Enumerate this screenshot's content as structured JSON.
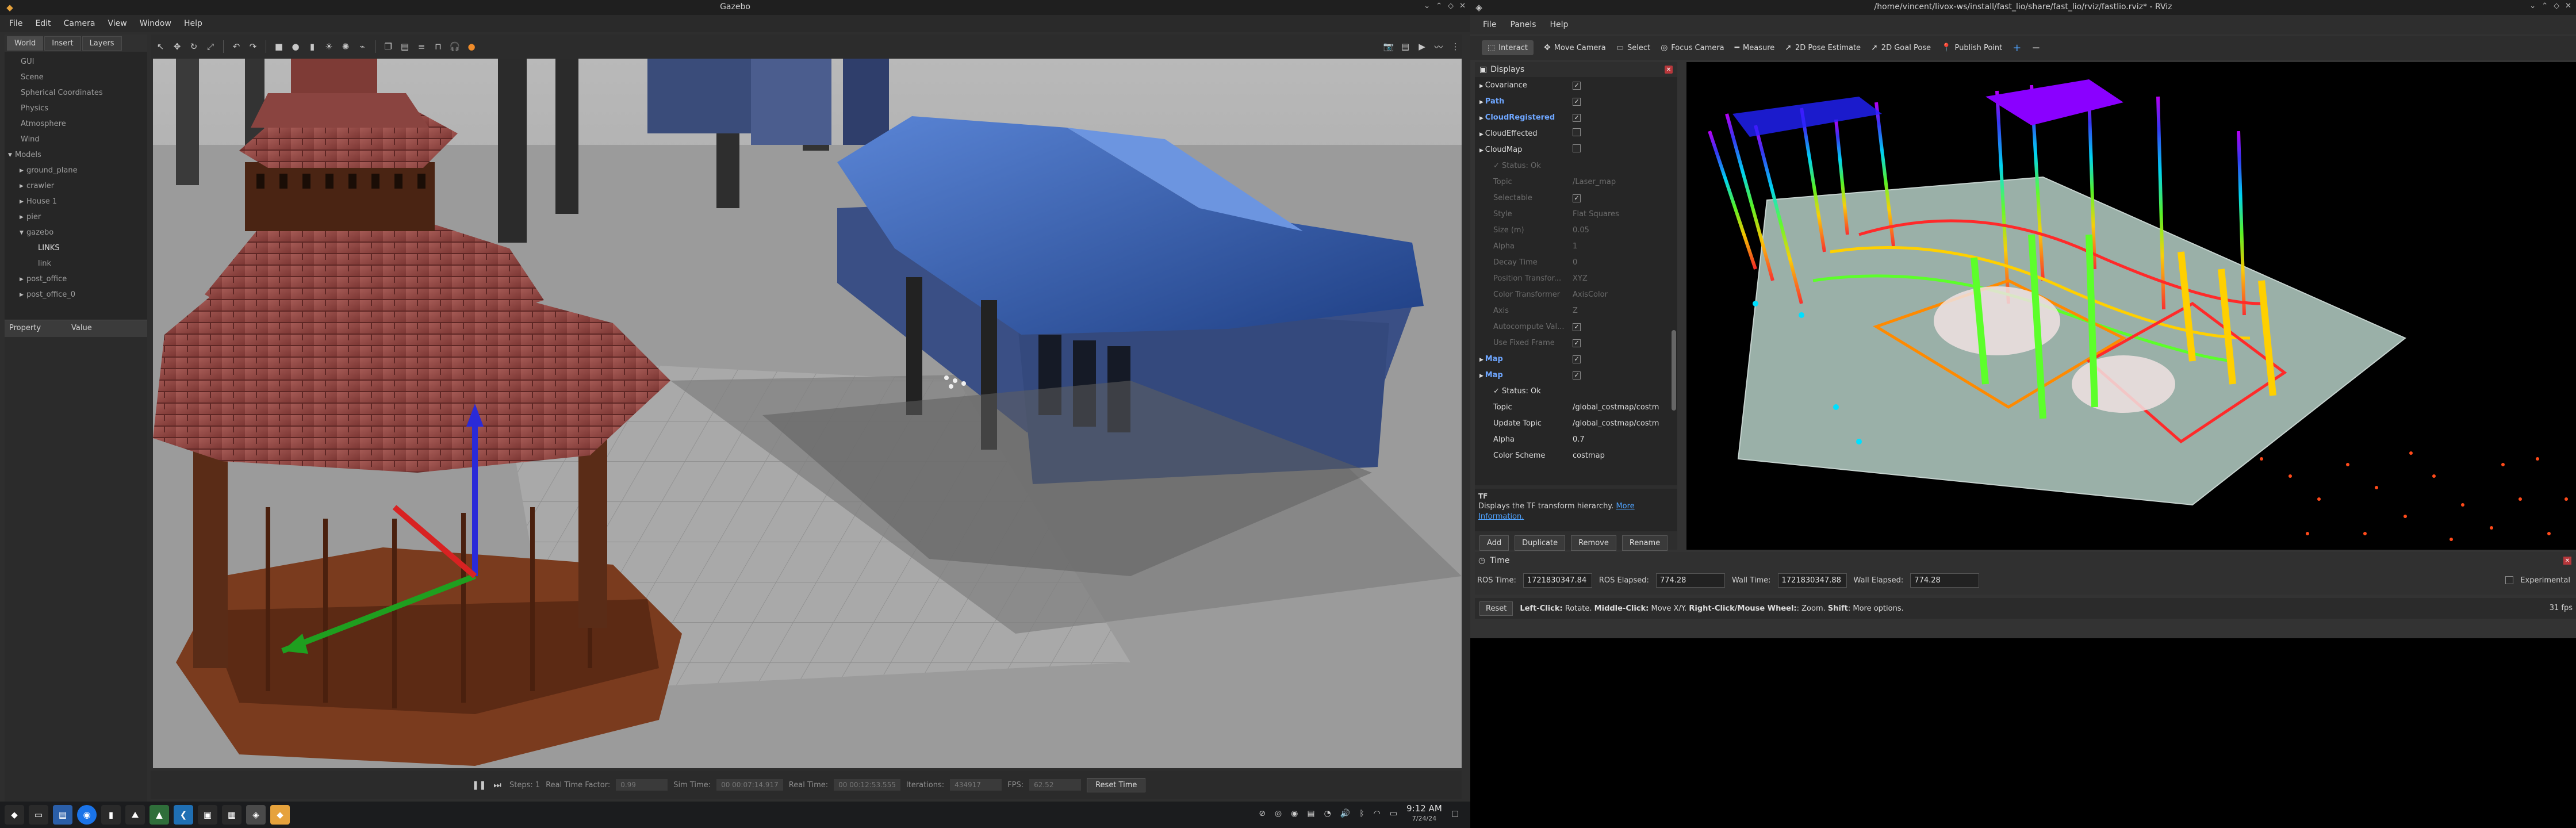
{
  "gazebo": {
    "title": "Gazebo",
    "menu": [
      "File",
      "Edit",
      "Camera",
      "View",
      "Window",
      "Help"
    ],
    "tabs": [
      "World",
      "Insert",
      "Layers"
    ],
    "tree": [
      {
        "label": "GUI",
        "indent": 1,
        "twisty": ""
      },
      {
        "label": "Scene",
        "indent": 1,
        "twisty": ""
      },
      {
        "label": "Spherical Coordinates",
        "indent": 1,
        "twisty": ""
      },
      {
        "label": "Physics",
        "indent": 1,
        "twisty": ""
      },
      {
        "label": "Atmosphere",
        "indent": 1,
        "twisty": ""
      },
      {
        "label": "Wind",
        "indent": 1,
        "twisty": ""
      },
      {
        "label": "Models",
        "indent": 0,
        "twisty": "▼"
      },
      {
        "label": "ground_plane",
        "indent": 2,
        "twisty": "▶"
      },
      {
        "label": "crawler",
        "indent": 2,
        "twisty": "▶"
      },
      {
        "label": "House 1",
        "indent": 2,
        "twisty": "▶"
      },
      {
        "label": "pier",
        "indent": 2,
        "twisty": "▶"
      },
      {
        "label": "gazebo",
        "indent": 2,
        "twisty": "▼"
      },
      {
        "label": "LINKS",
        "indent": 4,
        "twisty": ""
      },
      {
        "label": "link",
        "indent": 4,
        "twisty": ""
      },
      {
        "label": "post_office",
        "indent": 2,
        "twisty": "▶"
      },
      {
        "label": "post_office_0",
        "indent": 2,
        "twisty": "▶"
      }
    ],
    "props_headers": {
      "property": "Property",
      "value": "Value"
    },
    "bottom": {
      "steps": "Steps: 1",
      "real_time_factor_label": "Real Time Factor:",
      "real_time_factor": "0.99",
      "sim_time_label": "Sim Time:",
      "sim_time": "00 00:07:14.917",
      "real_time_label": "Real Time:",
      "real_time": "00 00:12:53.555",
      "iterations_label": "Iterations:",
      "iterations": "434917",
      "fps_label": "FPS:",
      "fps": "62.52",
      "reset_time": "Reset Time"
    }
  },
  "rviz": {
    "title": "/home/vincent/livox-ws/install/fast_lio/share/fast_lio/rviz/fastlio.rviz* - RViz",
    "menu": [
      "File",
      "Panels",
      "Help"
    ],
    "tools": [
      {
        "label": "Interact",
        "icon": "⬚"
      },
      {
        "label": "Move Camera",
        "icon": "✥"
      },
      {
        "label": "Select",
        "icon": "▭"
      },
      {
        "label": "Focus Camera",
        "icon": "◎"
      },
      {
        "label": "Measure",
        "icon": "━"
      },
      {
        "label": "2D Pose Estimate",
        "icon": "➚"
      },
      {
        "label": "2D Goal Pose",
        "icon": "➚"
      },
      {
        "label": "Publish Point",
        "icon": "📍"
      }
    ],
    "displays_title": "Displays",
    "displays": [
      {
        "name": "Covariance",
        "value": "",
        "check": true,
        "style": "lit"
      },
      {
        "name": "Path",
        "value": "",
        "check": true,
        "style": "blue"
      },
      {
        "name": "CloudRegistered",
        "value": "",
        "check": true,
        "style": "blue"
      },
      {
        "name": "CloudEffected",
        "value": "",
        "check": false,
        "style": "lit"
      },
      {
        "name": "CloudMap",
        "value": "",
        "check": false,
        "style": "lit"
      },
      {
        "name": "✓ Status: Ok",
        "value": "",
        "check": null,
        "style": "dim"
      },
      {
        "name": "Topic",
        "value": "/Laser_map",
        "check": null,
        "style": "dim"
      },
      {
        "name": "Selectable",
        "value": "",
        "check": true,
        "style": "dim"
      },
      {
        "name": "Style",
        "value": "Flat Squares",
        "check": null,
        "style": "dim"
      },
      {
        "name": "Size (m)",
        "value": "0.05",
        "check": null,
        "style": "dim"
      },
      {
        "name": "Alpha",
        "value": "1",
        "check": null,
        "style": "dim"
      },
      {
        "name": "Decay Time",
        "value": "0",
        "check": null,
        "style": "dim"
      },
      {
        "name": "Position Transfor...",
        "value": "XYZ",
        "check": null,
        "style": "dim"
      },
      {
        "name": "Color Transformer",
        "value": "AxisColor",
        "check": null,
        "style": "dim"
      },
      {
        "name": "Axis",
        "value": "Z",
        "check": null,
        "style": "dim"
      },
      {
        "name": "Autocompute Val...",
        "value": "",
        "check": true,
        "style": "dim"
      },
      {
        "name": "Use Fixed Frame",
        "value": "",
        "check": true,
        "style": "dim"
      },
      {
        "name": "Map",
        "value": "",
        "check": true,
        "style": "blue"
      },
      {
        "name": "Map",
        "value": "",
        "check": true,
        "style": "blue"
      },
      {
        "name": "✓ Status: Ok",
        "value": "",
        "check": null,
        "style": "lit"
      },
      {
        "name": "Topic",
        "value": "/global_costmap/costm",
        "check": null,
        "style": "lit"
      },
      {
        "name": "Update Topic",
        "value": "/global_costmap/costm",
        "check": null,
        "style": "lit"
      },
      {
        "name": "Alpha",
        "value": "0.7",
        "check": null,
        "style": "lit"
      },
      {
        "name": "Color Scheme",
        "value": "costmap",
        "check": null,
        "style": "lit"
      }
    ],
    "desc_title": "TF",
    "desc_text": "Displays the TF transform hierarchy.",
    "desc_link": "More Information.",
    "buttons": [
      "Add",
      "Duplicate",
      "Remove",
      "Rename"
    ],
    "time_title": "Time",
    "ros_time_label": "ROS Time:",
    "ros_time": "1721830347.84",
    "ros_elapsed_label": "ROS Elapsed:",
    "ros_elapsed": "774.28",
    "wall_time_label": "Wall Time:",
    "wall_time": "1721830347.88",
    "wall_elapsed_label": "Wall Elapsed:",
    "wall_elapsed": "774.28",
    "experimental": "Experimental",
    "reset": "Reset",
    "hint_bold1": "Left-Click:",
    "hint_1": " Rotate. ",
    "hint_bold2": "Middle-Click:",
    "hint_2": " Move X/Y. ",
    "hint_bold3": "Right-Click/Mouse Wheel:",
    "hint_3": ": Zoom. ",
    "hint_bold4": "Shift",
    "hint_4": ": More options.",
    "fps": "31 fps"
  },
  "taskbar": {
    "time": "9:12 AM",
    "date": "7/24/24"
  }
}
